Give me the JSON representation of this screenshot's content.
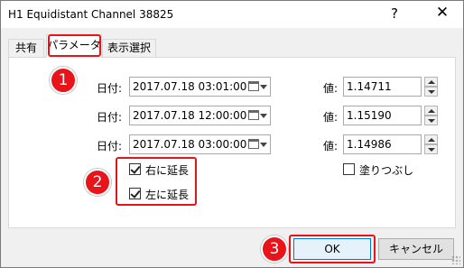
{
  "window": {
    "title": "H1 Equidistant Channel 38825",
    "help_label": "?",
    "close_label": "✕"
  },
  "tabs": [
    {
      "label": "共有"
    },
    {
      "label": "パラメータ"
    },
    {
      "label": "表示選択"
    }
  ],
  "markers": [
    "1",
    "2",
    "3"
  ],
  "rows": [
    {
      "date_label": "日付:",
      "date_value": "2017.07.18 03:01:00",
      "value_label": "値:",
      "value": "1.14711"
    },
    {
      "date_label": "日付:",
      "date_value": "2017.07.18 12:00:00",
      "value_label": "値:",
      "value": "1.15190"
    },
    {
      "date_label": "日付:",
      "date_value": "2017.07.18 03:00:00",
      "value_label": "値:",
      "value": "1.14986"
    }
  ],
  "options": {
    "extend_right": {
      "label": "右に延長",
      "checked": true
    },
    "extend_left": {
      "label": "左に延長",
      "checked": true
    },
    "fill": {
      "label": "塗りつぶし",
      "checked": false
    }
  },
  "buttons": {
    "ok": "OK",
    "cancel": "キャンセル"
  },
  "colors": {
    "highlight": "#e8141a",
    "accent": "#0078d7"
  },
  "icons": [
    "calendar-icon",
    "dropdown-arrow-icon",
    "spin-up-icon",
    "spin-down-icon",
    "close-icon",
    "help-icon",
    "size-grip-icon"
  ]
}
